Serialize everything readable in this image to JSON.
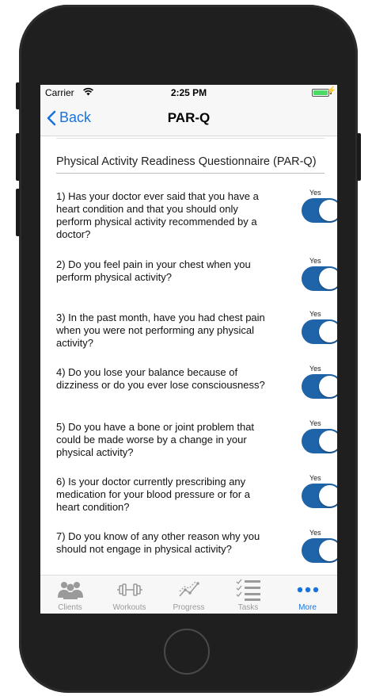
{
  "status_bar": {
    "carrier": "Carrier",
    "time": "2:25 PM"
  },
  "nav": {
    "back_label": "Back",
    "title": "PAR-Q"
  },
  "form": {
    "heading": "Physical Activity Readiness Questionnaire (PAR-Q)",
    "questions": [
      {
        "text": "1) Has your doctor ever said that you have a heart condition and that you should only perform physical activity recommended by a doctor?",
        "toggle_label": "Yes",
        "checked": true
      },
      {
        "text": "2) Do you feel pain in your chest when you perform physical activity?",
        "toggle_label": "Yes",
        "checked": true
      },
      {
        "text": "3) In the past month, have you had chest pain when you were not performing any physical activity?",
        "toggle_label": "Yes",
        "checked": true
      },
      {
        "text": "4) Do you lose your balance because of dizziness or do you ever lose consciousness?",
        "toggle_label": "Yes",
        "checked": true
      },
      {
        "text": "5) Do you have a bone or joint problem that could be made worse by a change in your physical activity?",
        "toggle_label": "Yes",
        "checked": true
      },
      {
        "text": "6) Is your doctor currently prescribing any medication for your blood pressure or for a heart condition?",
        "toggle_label": "Yes",
        "checked": true
      },
      {
        "text": "7) Do you know of any other reason why you should not engage in physical activity?",
        "toggle_label": "Yes",
        "checked": true
      }
    ]
  },
  "tabbar": {
    "tabs": [
      {
        "label": "Clients",
        "icon": "clients-icon",
        "active": false
      },
      {
        "label": "Workouts",
        "icon": "dumbbell-icon",
        "active": false
      },
      {
        "label": "Progress",
        "icon": "progress-chart-icon",
        "active": false
      },
      {
        "label": "Tasks",
        "icon": "tasks-checklist-icon",
        "active": false
      },
      {
        "label": "More",
        "icon": "more-dots-icon",
        "active": true
      }
    ]
  },
  "colors": {
    "accent": "#1a73d9",
    "toggle_on": "#1f63a8",
    "inactive_tab": "#9a9a9a",
    "frame": "#1f1f1f"
  }
}
